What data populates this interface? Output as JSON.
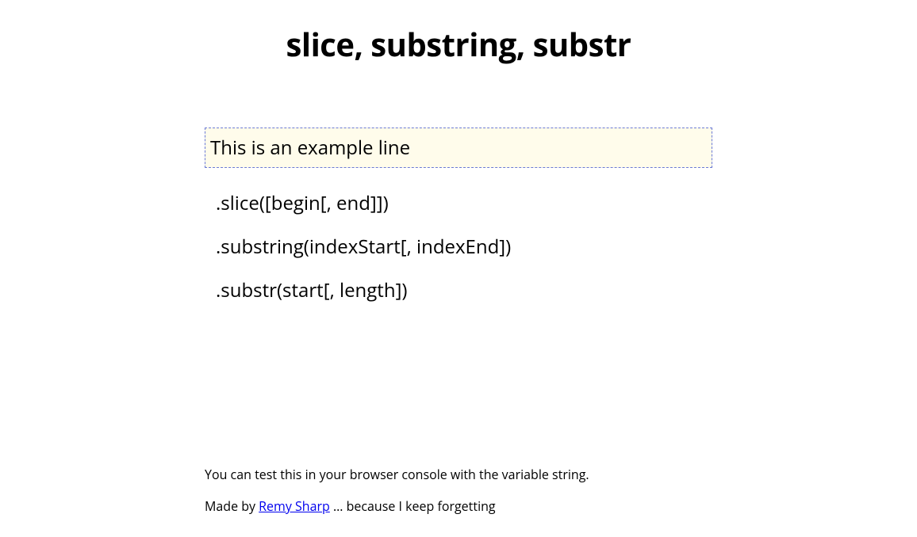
{
  "title": "slice, substring, substr",
  "input_value": "This is an example line",
  "methods": [
    ".slice([begin[, end]])",
    ".substring(indexStart[, indexEnd])",
    ".substr(start[, length])"
  ],
  "footer": {
    "hint": "You can test this in your browser console with the variable string.",
    "made_by_prefix": "Made by ",
    "author_name": "Remy Sharp",
    "made_by_suffix": " … because I keep forgetting"
  }
}
